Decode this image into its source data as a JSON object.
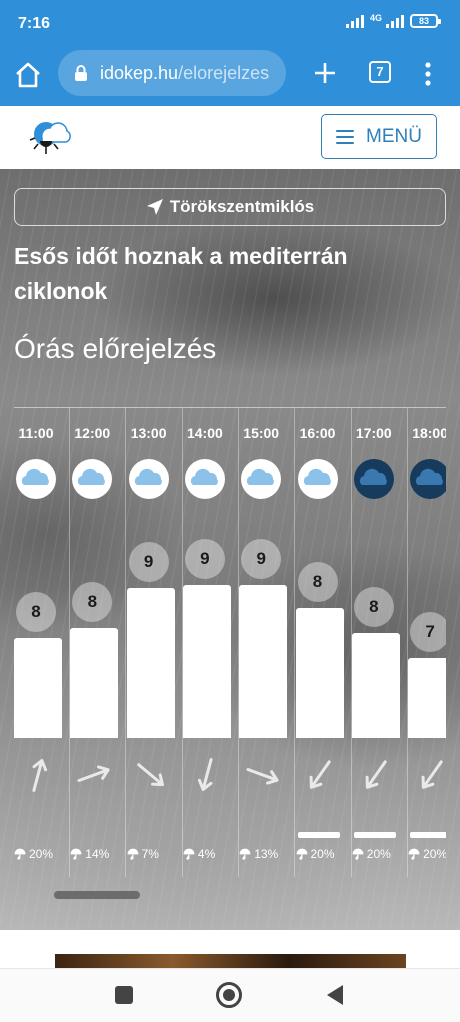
{
  "status": {
    "time": "7:16",
    "network": "4G",
    "battery": "83"
  },
  "browser": {
    "url_domain": "idokep.hu",
    "url_path": "/elorejelzes",
    "tab_count": "7"
  },
  "site": {
    "menu_label": "MENÜ"
  },
  "page": {
    "location": "Törökszentmiklós",
    "headline": "Esős időt hoznak a mediterrán ciklonok",
    "section_title": "Órás előrejelzés"
  },
  "forecast": {
    "hours": [
      {
        "time": "11:00",
        "icon": "cloudy-icon",
        "temp": "8",
        "temp_value": 8,
        "wind": "wind-arrow-ssw-icon",
        "precip": "20%",
        "rain_mark": false
      },
      {
        "time": "12:00",
        "icon": "cloudy-icon",
        "temp": "8",
        "temp_value": 8.2,
        "wind": "wind-arrow-wsw-icon",
        "precip": "14%",
        "rain_mark": false
      },
      {
        "time": "13:00",
        "icon": "cloudy-icon",
        "temp": "9",
        "temp_value": 9,
        "wind": "wind-arrow-nw-icon",
        "precip": "7%",
        "rain_mark": false
      },
      {
        "time": "14:00",
        "icon": "cloudy-icon",
        "temp": "9",
        "temp_value": 9.05,
        "wind": "wind-arrow-nne-icon",
        "precip": "4%",
        "rain_mark": false
      },
      {
        "time": "15:00",
        "icon": "cloudy-icon",
        "temp": "9",
        "temp_value": 9.05,
        "wind": "wind-arrow-wnw-icon",
        "precip": "13%",
        "rain_mark": false
      },
      {
        "time": "16:00",
        "icon": "cloudy-icon",
        "temp": "8",
        "temp_value": 8.6,
        "wind": "wind-arrow-ne-icon",
        "precip": "20%",
        "rain_mark": true
      },
      {
        "time": "17:00",
        "icon": "rain-cloud-icon",
        "temp": "8",
        "temp_value": 8.1,
        "wind": "wind-arrow-ne-icon",
        "precip": "20%",
        "rain_mark": true
      },
      {
        "time": "18:00",
        "icon": "rain-cloud-icon",
        "temp": "7",
        "temp_value": 7.6,
        "wind": "wind-arrow-ne-icon",
        "precip": "20%",
        "rain_mark": true
      }
    ]
  },
  "colors": {
    "primary": "#2f8fd9",
    "accent": "#2f7fb8",
    "rain_icon": "#1f4f7a"
  }
}
